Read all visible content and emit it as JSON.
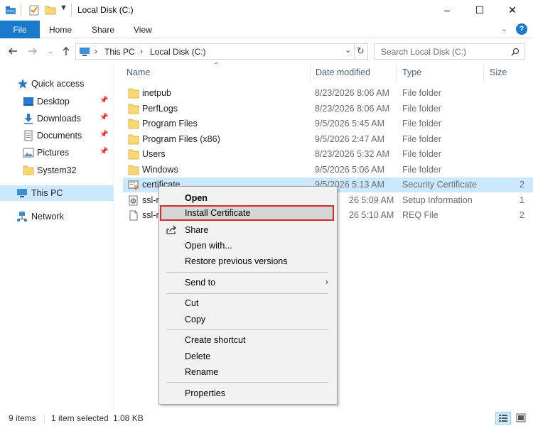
{
  "window": {
    "title": "Local Disk (C:)",
    "minimize": "–",
    "maximize": "☐",
    "close": "✕"
  },
  "ribbon": {
    "file_tab": "File",
    "tabs": [
      "Home",
      "Share",
      "View"
    ]
  },
  "address": {
    "breadcrumb": [
      "This PC",
      "Local Disk (C:)"
    ],
    "search_placeholder": "Search Local Disk (C:)"
  },
  "navpane": {
    "quick_access": "Quick access",
    "pinned": [
      {
        "label": "Desktop",
        "icon": "desktop-icon"
      },
      {
        "label": "Downloads",
        "icon": "downloads-icon"
      },
      {
        "label": "Documents",
        "icon": "documents-icon"
      },
      {
        "label": "Pictures",
        "icon": "pictures-icon"
      }
    ],
    "system32": "System32",
    "this_pc": "This PC",
    "network": "Network"
  },
  "columns": {
    "name": "Name",
    "date": "Date modified",
    "type": "Type",
    "size": "Size"
  },
  "files": [
    {
      "name": "inetpub",
      "date": "8/23/2026 8:06 AM",
      "type": "File folder",
      "size": "",
      "icon": "folder-icon"
    },
    {
      "name": "PerfLogs",
      "date": "8/23/2026 8:06 AM",
      "type": "File folder",
      "size": "",
      "icon": "folder-icon"
    },
    {
      "name": "Program Files",
      "date": "9/5/2026 5:45 AM",
      "type": "File folder",
      "size": "",
      "icon": "folder-icon"
    },
    {
      "name": "Program Files (x86)",
      "date": "9/5/2026 2:47 AM",
      "type": "File folder",
      "size": "",
      "icon": "folder-icon"
    },
    {
      "name": "Users",
      "date": "8/23/2026 5:32 AM",
      "type": "File folder",
      "size": "",
      "icon": "folder-icon"
    },
    {
      "name": "Windows",
      "date": "9/5/2026 5:06 AM",
      "type": "File folder",
      "size": "",
      "icon": "folder-icon"
    },
    {
      "name": "certificate",
      "date": "9/5/2026 5:13 AM",
      "type": "Security Certificate",
      "size": "2",
      "icon": "certificate-icon"
    },
    {
      "name": "ssl-r",
      "date": "26 5:09 AM",
      "type": "Setup Information",
      "size": "1",
      "icon": "setup-info-icon"
    },
    {
      "name": "ssl-r",
      "date": "26 5:10 AM",
      "type": "REQ File",
      "size": "2",
      "icon": "file-icon"
    }
  ],
  "context_menu": {
    "open": "Open",
    "install_certificate": "Install Certificate",
    "share": "Share",
    "open_with": "Open with...",
    "restore": "Restore previous versions",
    "send_to": "Send to",
    "cut": "Cut",
    "copy": "Copy",
    "create_shortcut": "Create shortcut",
    "delete": "Delete",
    "rename": "Rename",
    "properties": "Properties"
  },
  "status": {
    "items": "9 items",
    "selected": "1 item selected",
    "size": "1.08 KB"
  },
  "colors": {
    "accent": "#1979ca",
    "selection": "#cce8ff",
    "highlight_border": "#d62e2e",
    "folder": "#f8d775"
  }
}
